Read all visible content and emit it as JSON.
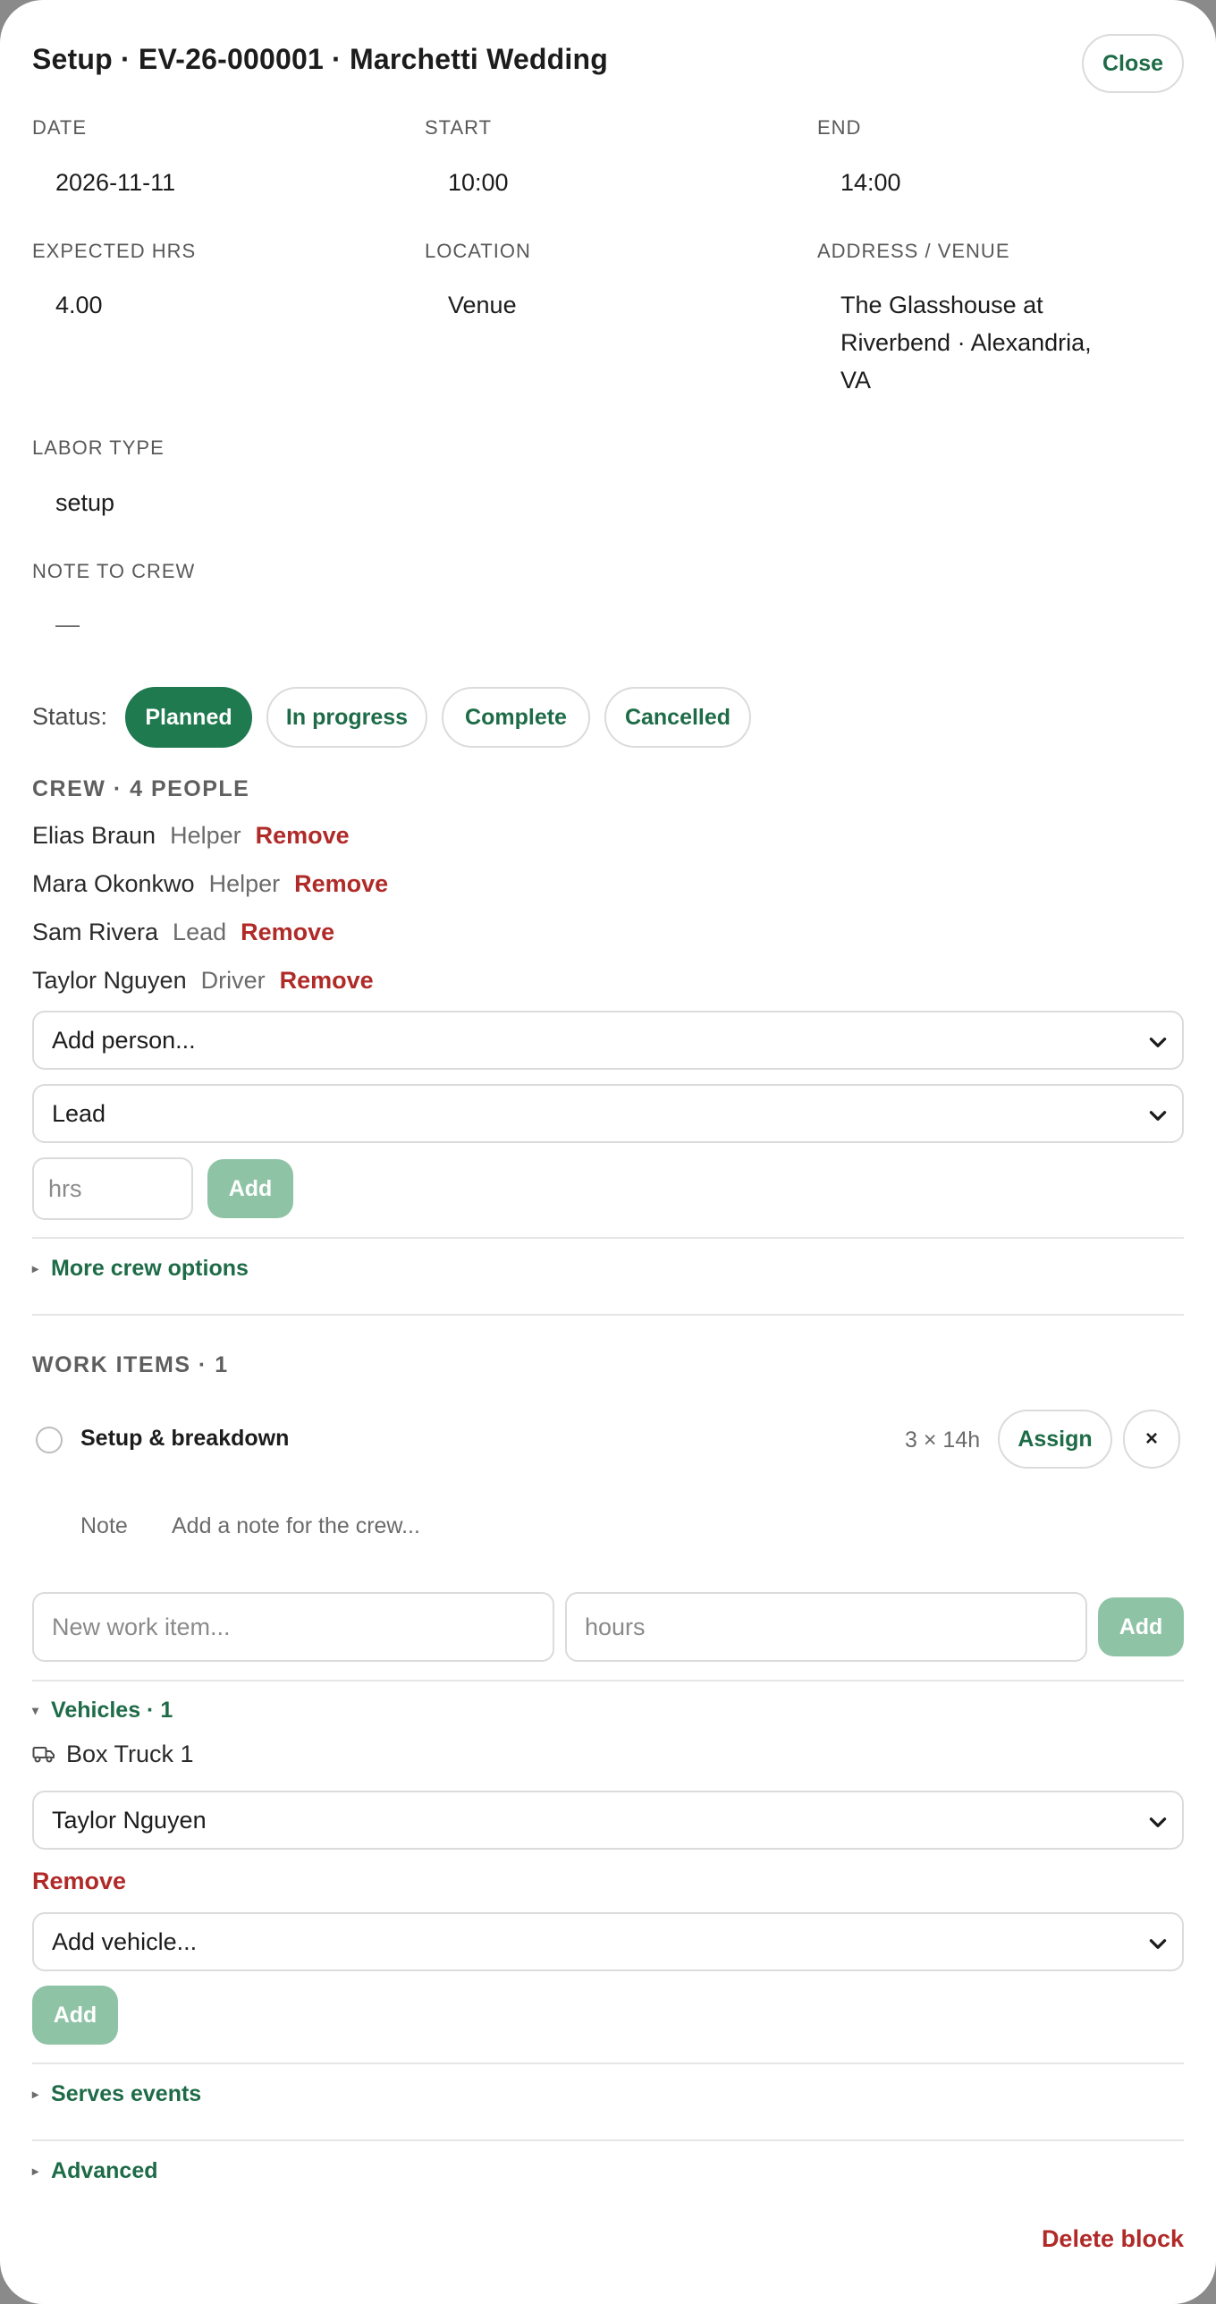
{
  "header": {
    "title": "Setup · EV-26-000001 · Marchetti Wedding",
    "close_label": "Close"
  },
  "fields": {
    "date_label": "DATE",
    "date_value": "2026-11-11",
    "start_label": "START",
    "start_value": "10:00",
    "end_label": "END",
    "end_value": "14:00",
    "expected_label": "EXPECTED HRS",
    "expected_value": "4.00",
    "location_label": "LOCATION",
    "location_value": "Venue",
    "address_label": "ADDRESS / VENUE",
    "address_value": "The Glasshouse at Riverbend · Alexandria, VA",
    "labor_label": "LABOR TYPE",
    "labor_value": "setup",
    "note_label": "NOTE TO CREW",
    "note_value": "—"
  },
  "status": {
    "label": "Status:",
    "options": [
      "Planned",
      "In progress",
      "Complete",
      "Cancelled"
    ],
    "selected": "Planned"
  },
  "crew": {
    "heading": "CREW · 4 PEOPLE",
    "remove_label": "Remove",
    "members": [
      {
        "name": "Elias Braun",
        "role": "Helper"
      },
      {
        "name": "Mara Okonkwo",
        "role": "Helper"
      },
      {
        "name": "Sam Rivera",
        "role": "Lead"
      },
      {
        "name": "Taylor Nguyen",
        "role": "Driver"
      }
    ],
    "add_person_placeholder": "Add person...",
    "role_select_value": "Lead",
    "hrs_placeholder": "hrs",
    "add_label": "Add",
    "more_options_label": "More crew options"
  },
  "work_items": {
    "heading": "WORK ITEMS · 1",
    "items": [
      {
        "name": "Setup & breakdown",
        "qty": "3 × 14h",
        "assign_label": "Assign",
        "remove_label": "×"
      }
    ],
    "note_label": "Note",
    "note_placeholder": "Add a note for the crew...",
    "new_item_placeholder": "New work item...",
    "hours_placeholder": "hours",
    "add_label": "Add"
  },
  "vehicles": {
    "heading": "Vehicles · 1",
    "items": [
      {
        "name": "Box Truck 1",
        "driver": "Taylor Nguyen"
      }
    ],
    "remove_label": "Remove",
    "add_vehicle_placeholder": "Add vehicle...",
    "add_label": "Add"
  },
  "serves_events_label": "Serves events",
  "advanced_label": "Advanced",
  "delete_label": "Delete block",
  "colors": {
    "accent": "#1f7a4f",
    "accent_text": "#1e6b47",
    "danger": "#b02a28",
    "disabled_green": "#8fc3a6"
  }
}
